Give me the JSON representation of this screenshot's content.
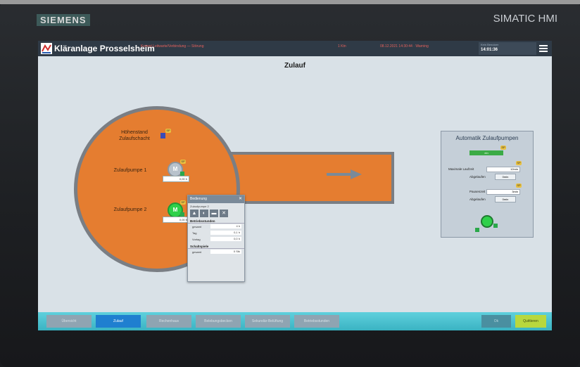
{
  "device": {
    "brand": "SIEMENS",
    "model": "SIMATIC HMI"
  },
  "header": {
    "app_title": "Kläranlage Prosselsheim",
    "alarm_text": "Kommt Leitwarte/Verbindung — Störung",
    "alarm_count": "1 Ktn",
    "alarm_time": "08.12.2021 14:30:44 · Warning",
    "user": "Kein Benutzer",
    "clock": "14:01:36"
  },
  "page": {
    "title": "Zulauf"
  },
  "basin": {
    "level_label": "Höhenstand\nZulaufschacht",
    "pump1_label": "Zulaufpumpe 1",
    "pump2_label": "Zulaufpumpe 2",
    "pump1_value": "0,00 h",
    "pump2_value": "0,00 h",
    "motor_symbol": "M",
    "tag_symbol": "SP",
    "local_symbol": "A"
  },
  "popup": {
    "title": "Bedienung",
    "subtitle": "Zulaufpumpe 2",
    "close": "✕",
    "section_hours": "Betriebsstunden",
    "rows": [
      {
        "label": "gesamt",
        "value": "4 h"
      },
      {
        "label": "Tag",
        "value": "0,1 h"
      },
      {
        "label": "Vortag",
        "value": "0,0 h"
      }
    ],
    "section_switch": "Schaltspiele",
    "switch_rows": [
      {
        "label": "gesamt",
        "value": "0 Stk"
      }
    ]
  },
  "auto_panel": {
    "title": "Automatik Zulaufpumpen",
    "bar_label": "ein",
    "max_runtime_label": "Maximale Laufzeit",
    "max_runtime_value": "12min",
    "elapsed1_label": "Abgelaufen",
    "elapsed1_value": "0min",
    "pause_label": "Pausenzeit",
    "pause_value": "3min",
    "elapsed2_label": "Abgelaufen",
    "elapsed2_value": "0min"
  },
  "nav": {
    "items": [
      {
        "label": "Übersicht",
        "style": "disabled"
      },
      {
        "label": "Zulauf",
        "style": "active"
      },
      {
        "label": "Rechenhaus",
        "style": "disabled"
      },
      {
        "label": "Belebungsbecken",
        "style": "disabled"
      },
      {
        "label": "Sekundär-Belüftung",
        "style": "disabled"
      },
      {
        "label": "Betriebsstunden",
        "style": "disabled"
      }
    ],
    "ok_label": "Ok",
    "acknowledge_label": "Quittieren"
  }
}
